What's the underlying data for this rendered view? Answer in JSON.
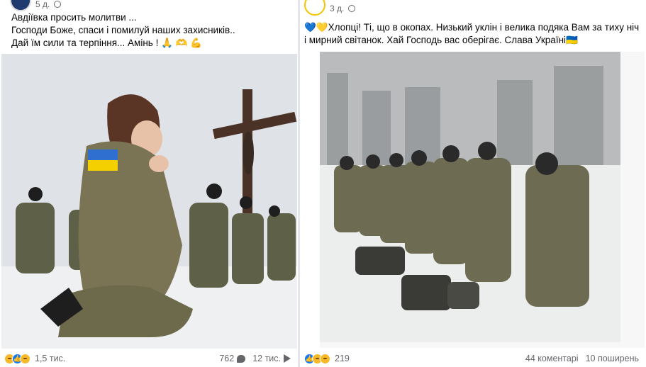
{
  "left_post": {
    "time": "5 д.",
    "text": "Авдіївка просить молитви ...\nГосподи Боже, спаси і помилуй наших захисників..\nДай їм сили та терпіння... Амінь ! 🙏 🫶 💪",
    "photo_icon": "photo-woman-soldier-praying-cross",
    "reactions_count": "1,5 тис.",
    "comments_count": "762",
    "shares_count": "12 тис."
  },
  "right_post": {
    "time": "3 д.",
    "text": "💙💛Хлопці! Ті, що в окопах. Низький уклін і велика подяка Вам за тиху ніч і мирний світанок. Хай Господь вас оберігає. Слава Україні🇺🇦",
    "photo_icon": "photo-soldiers-kneeling-in-snow",
    "reactions_count": "219",
    "comments_label": "44 коментарі",
    "shares_label": "10 поширень"
  },
  "colors": {
    "like_blue": "#1877f2",
    "care_yellow": "#f7b928",
    "camo": "#6b6a4a",
    "ua_blue": "#2f6fd0",
    "ua_yellow": "#f5d000"
  }
}
